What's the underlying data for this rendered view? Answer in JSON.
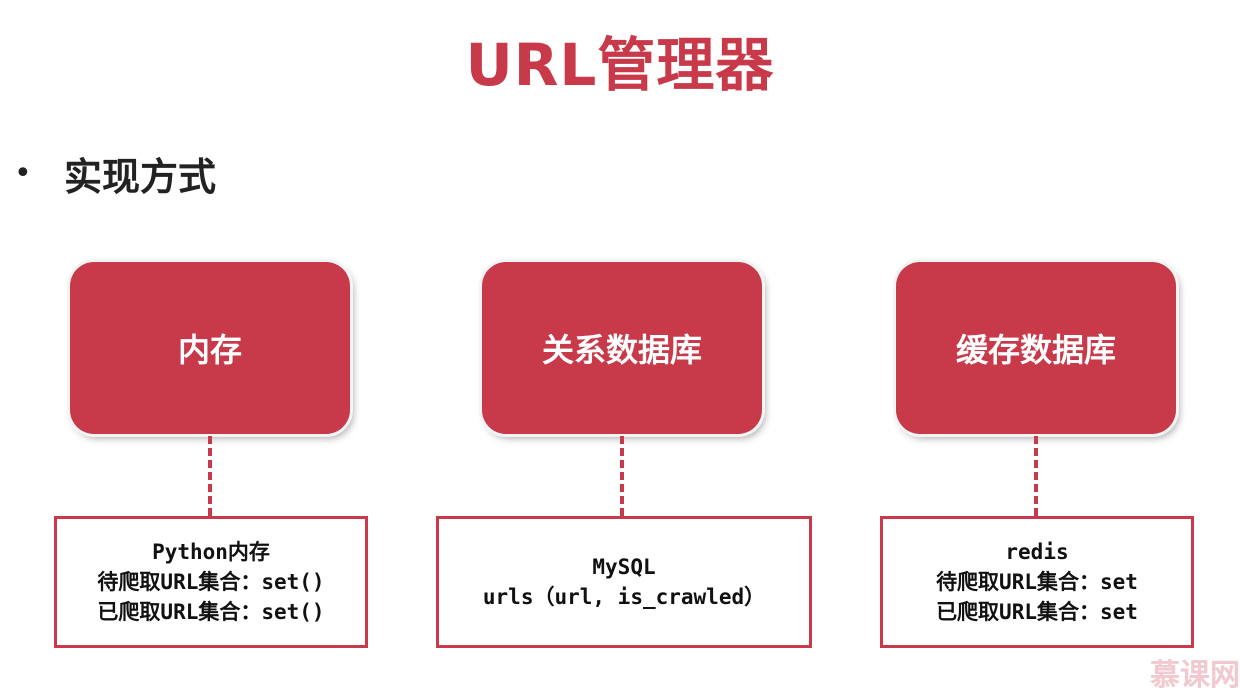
{
  "title": "URL管理器",
  "bullet": "实现方式",
  "nodes": [
    {
      "label": "内存",
      "detail": [
        "Python内存",
        "待爬取URL集合：set()",
        "已爬取URL集合：set()"
      ]
    },
    {
      "label": "关系数据库",
      "detail": [
        "MySQL",
        "urls（url, is_crawled）"
      ]
    },
    {
      "label": "缓存数据库",
      "detail": [
        "redis",
        "待爬取URL集合：set",
        "已爬取URL集合：set"
      ]
    }
  ],
  "watermark": "慕课网",
  "colors": {
    "accent": "#c8394a",
    "text": "#222222"
  }
}
